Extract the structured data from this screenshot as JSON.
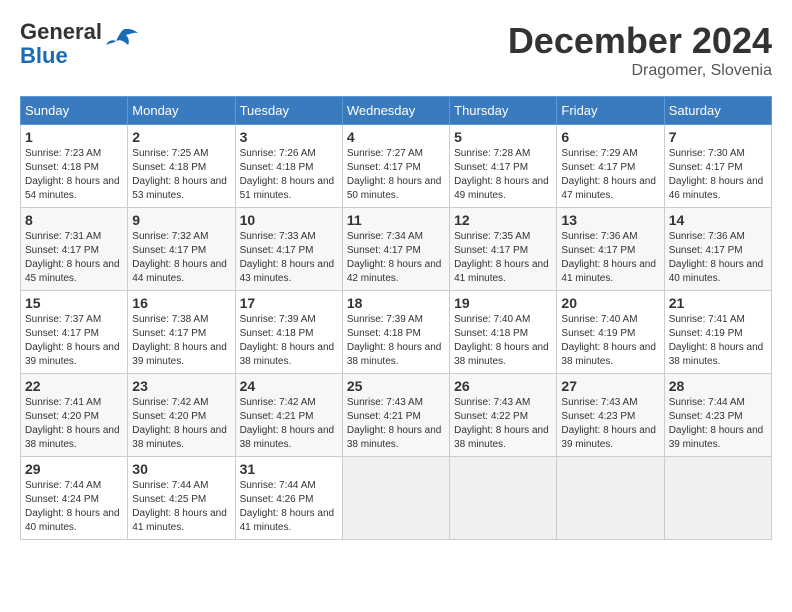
{
  "header": {
    "logo_line1": "General",
    "logo_line2": "Blue",
    "month_year": "December 2024",
    "location": "Dragomer, Slovenia"
  },
  "columns": [
    "Sunday",
    "Monday",
    "Tuesday",
    "Wednesday",
    "Thursday",
    "Friday",
    "Saturday"
  ],
  "weeks": [
    [
      {
        "day": "1",
        "sunrise": "7:23 AM",
        "sunset": "4:18 PM",
        "daylight": "8 hours and 54 minutes."
      },
      {
        "day": "2",
        "sunrise": "7:25 AM",
        "sunset": "4:18 PM",
        "daylight": "8 hours and 53 minutes."
      },
      {
        "day": "3",
        "sunrise": "7:26 AM",
        "sunset": "4:18 PM",
        "daylight": "8 hours and 51 minutes."
      },
      {
        "day": "4",
        "sunrise": "7:27 AM",
        "sunset": "4:17 PM",
        "daylight": "8 hours and 50 minutes."
      },
      {
        "day": "5",
        "sunrise": "7:28 AM",
        "sunset": "4:17 PM",
        "daylight": "8 hours and 49 minutes."
      },
      {
        "day": "6",
        "sunrise": "7:29 AM",
        "sunset": "4:17 PM",
        "daylight": "8 hours and 47 minutes."
      },
      {
        "day": "7",
        "sunrise": "7:30 AM",
        "sunset": "4:17 PM",
        "daylight": "8 hours and 46 minutes."
      }
    ],
    [
      {
        "day": "8",
        "sunrise": "7:31 AM",
        "sunset": "4:17 PM",
        "daylight": "8 hours and 45 minutes."
      },
      {
        "day": "9",
        "sunrise": "7:32 AM",
        "sunset": "4:17 PM",
        "daylight": "8 hours and 44 minutes."
      },
      {
        "day": "10",
        "sunrise": "7:33 AM",
        "sunset": "4:17 PM",
        "daylight": "8 hours and 43 minutes."
      },
      {
        "day": "11",
        "sunrise": "7:34 AM",
        "sunset": "4:17 PM",
        "daylight": "8 hours and 42 minutes."
      },
      {
        "day": "12",
        "sunrise": "7:35 AM",
        "sunset": "4:17 PM",
        "daylight": "8 hours and 41 minutes."
      },
      {
        "day": "13",
        "sunrise": "7:36 AM",
        "sunset": "4:17 PM",
        "daylight": "8 hours and 41 minutes."
      },
      {
        "day": "14",
        "sunrise": "7:36 AM",
        "sunset": "4:17 PM",
        "daylight": "8 hours and 40 minutes."
      }
    ],
    [
      {
        "day": "15",
        "sunrise": "7:37 AM",
        "sunset": "4:17 PM",
        "daylight": "8 hours and 39 minutes."
      },
      {
        "day": "16",
        "sunrise": "7:38 AM",
        "sunset": "4:17 PM",
        "daylight": "8 hours and 39 minutes."
      },
      {
        "day": "17",
        "sunrise": "7:39 AM",
        "sunset": "4:18 PM",
        "daylight": "8 hours and 38 minutes."
      },
      {
        "day": "18",
        "sunrise": "7:39 AM",
        "sunset": "4:18 PM",
        "daylight": "8 hours and 38 minutes."
      },
      {
        "day": "19",
        "sunrise": "7:40 AM",
        "sunset": "4:18 PM",
        "daylight": "8 hours and 38 minutes."
      },
      {
        "day": "20",
        "sunrise": "7:40 AM",
        "sunset": "4:19 PM",
        "daylight": "8 hours and 38 minutes."
      },
      {
        "day": "21",
        "sunrise": "7:41 AM",
        "sunset": "4:19 PM",
        "daylight": "8 hours and 38 minutes."
      }
    ],
    [
      {
        "day": "22",
        "sunrise": "7:41 AM",
        "sunset": "4:20 PM",
        "daylight": "8 hours and 38 minutes."
      },
      {
        "day": "23",
        "sunrise": "7:42 AM",
        "sunset": "4:20 PM",
        "daylight": "8 hours and 38 minutes."
      },
      {
        "day": "24",
        "sunrise": "7:42 AM",
        "sunset": "4:21 PM",
        "daylight": "8 hours and 38 minutes."
      },
      {
        "day": "25",
        "sunrise": "7:43 AM",
        "sunset": "4:21 PM",
        "daylight": "8 hours and 38 minutes."
      },
      {
        "day": "26",
        "sunrise": "7:43 AM",
        "sunset": "4:22 PM",
        "daylight": "8 hours and 38 minutes."
      },
      {
        "day": "27",
        "sunrise": "7:43 AM",
        "sunset": "4:23 PM",
        "daylight": "8 hours and 39 minutes."
      },
      {
        "day": "28",
        "sunrise": "7:44 AM",
        "sunset": "4:23 PM",
        "daylight": "8 hours and 39 minutes."
      }
    ],
    [
      {
        "day": "29",
        "sunrise": "7:44 AM",
        "sunset": "4:24 PM",
        "daylight": "8 hours and 40 minutes."
      },
      {
        "day": "30",
        "sunrise": "7:44 AM",
        "sunset": "4:25 PM",
        "daylight": "8 hours and 41 minutes."
      },
      {
        "day": "31",
        "sunrise": "7:44 AM",
        "sunset": "4:26 PM",
        "daylight": "8 hours and 41 minutes."
      },
      null,
      null,
      null,
      null
    ]
  ]
}
